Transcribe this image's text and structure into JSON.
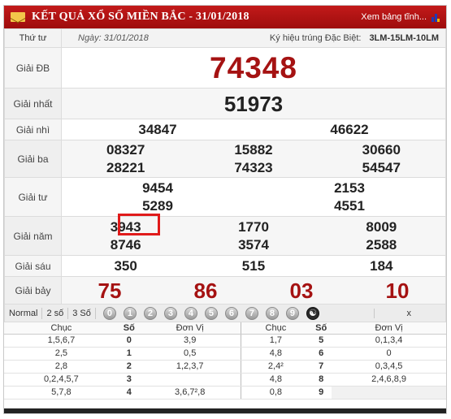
{
  "header": {
    "title": "KẾT QUẢ XỔ SỐ MIỀN BẮC - 31/01/2018",
    "view_more": "Xem bảng tĩnh...",
    "icons": [
      "envelope-icon",
      "signal-bars-icon"
    ]
  },
  "info": {
    "weekday": "Thứ tư",
    "date": "Ngày: 31/01/2018",
    "code_label": "Ký hiệu trúng Đặc Biệt:",
    "code": "3LM-15LM-10LM"
  },
  "prizes": {
    "db": {
      "label": "Giải ĐB",
      "numbers": [
        "74348"
      ]
    },
    "nhat": {
      "label": "Giải nhất",
      "numbers": [
        "51973"
      ]
    },
    "nhi": {
      "label": "Giải nhì",
      "numbers": [
        "34847",
        "46622"
      ]
    },
    "ba": {
      "label": "Giải ba",
      "numbers": [
        "08327",
        "15882",
        "30660",
        "28221",
        "74323",
        "54547"
      ]
    },
    "tu": {
      "label": "Giải tư",
      "numbers": [
        "9454",
        "2153",
        "5289",
        "4551"
      ]
    },
    "nam": {
      "label": "Giải năm",
      "numbers": [
        "3943",
        "1770",
        "8009",
        "8746",
        "3574",
        "2588"
      ]
    },
    "sau": {
      "label": "Giải sáu",
      "numbers": [
        "350",
        "515",
        "184"
      ]
    },
    "bay": {
      "label": "Giải bảy",
      "numbers": [
        "75",
        "86",
        "03",
        "10"
      ]
    }
  },
  "toolbar": {
    "buttons": [
      "Normal",
      "2 số",
      "3 Số"
    ],
    "digits": [
      "0",
      "1",
      "2",
      "3",
      "4",
      "5",
      "6",
      "7",
      "8",
      "9"
    ],
    "close": "x"
  },
  "loto": {
    "headers": {
      "chuc": "Chục",
      "so": "Số",
      "donvi": "Đơn Vị"
    },
    "left": [
      {
        "chuc": "1,5,6,7",
        "so": "0",
        "donvi": "3,9"
      },
      {
        "chuc": "2,5",
        "so": "1",
        "donvi": "0,5"
      },
      {
        "chuc": "2,8",
        "so": "2",
        "donvi": "1,2,3,7"
      },
      {
        "chuc": "0,2,4,5,7",
        "so": "3",
        "donvi": ""
      },
      {
        "chuc": "5,7,8",
        "so": "4",
        "donvi": "3,6,7²,8"
      }
    ],
    "right": [
      {
        "chuc": "1,7",
        "so": "5",
        "donvi": "0,1,3,4"
      },
      {
        "chuc": "4,8",
        "so": "6",
        "donvi": "0"
      },
      {
        "chuc": "2,4²",
        "so": "7",
        "donvi": "0,3,4,5"
      },
      {
        "chuc": "4,8",
        "so": "8",
        "donvi": "2,4,6,8,9"
      },
      {
        "chuc": "0,8",
        "so": "9",
        "donvi": ""
      }
    ]
  }
}
